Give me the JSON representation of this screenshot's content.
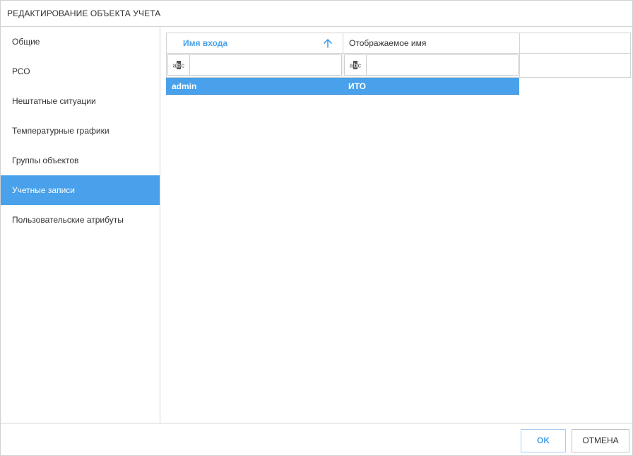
{
  "dialog": {
    "title": "РЕДАКТИРОВАНИЕ ОБЪЕКТА УЧЕТА"
  },
  "sidebar": {
    "items": [
      {
        "label": "Общие",
        "active": false
      },
      {
        "label": "РСО",
        "active": false
      },
      {
        "label": "Нештатные ситуации",
        "active": false
      },
      {
        "label": "Температурные графики",
        "active": false
      },
      {
        "label": "Группы объектов",
        "active": false
      },
      {
        "label": "Учетные записи",
        "active": true
      },
      {
        "label": "Пользовательские атрибуты",
        "active": false
      }
    ]
  },
  "grid": {
    "columns": [
      {
        "label": "Имя входа",
        "sort": "ascending"
      },
      {
        "label": "Отображаемое имя"
      }
    ],
    "filters": [
      {
        "value": "",
        "icon": "text-filter-icon"
      },
      {
        "value": "",
        "icon": "text-filter-icon"
      }
    ],
    "rows": [
      {
        "login": "admin",
        "display_name": "ИТО",
        "selected": true
      }
    ]
  },
  "footer": {
    "ok_label": "OK",
    "cancel_label": "ОТМЕНА"
  },
  "colors": {
    "accent": "#48a1ea"
  }
}
